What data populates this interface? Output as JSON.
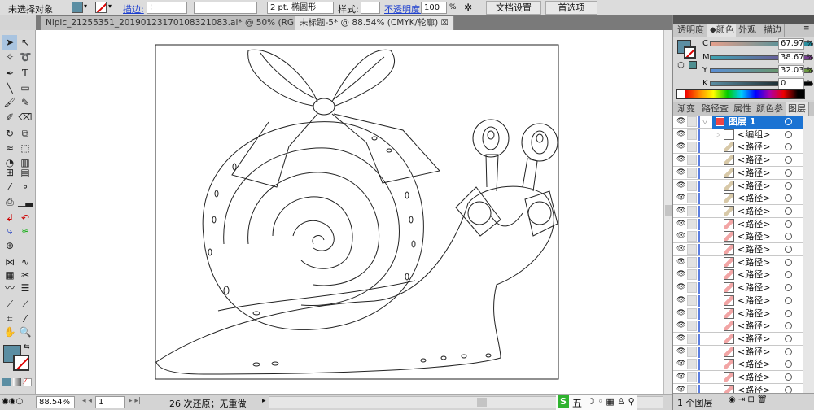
{
  "control_bar": {
    "selection": "未选择对象",
    "fill_color": "#5b8ea3",
    "stroke_label": "描边:",
    "stroke_weight": "2 pt. 椭圆形",
    "style_label": "样式:",
    "opacity_label": "不透明度:",
    "opacity_value": "100",
    "opacity_unit": "%",
    "doc_setup": "文档设置",
    "preferences": "首选项"
  },
  "tabs": [
    {
      "label": "Nipic_21255351_20190123170108321083.ai* @ 50% (RGB/轮廓)",
      "active": false
    },
    {
      "label": "未标题-5* @ 88.54% (CMYK/轮廓)",
      "active": true
    }
  ],
  "right_panel": {
    "top_tabs": [
      "透明度",
      "颜色",
      "外观",
      "描边"
    ],
    "active_top_tab": "颜色",
    "color": {
      "channels": [
        {
          "name": "C",
          "value": "67.97"
        },
        {
          "name": "M",
          "value": "38.67"
        },
        {
          "name": "Y",
          "value": "32.03"
        },
        {
          "name": "K",
          "value": "0"
        }
      ],
      "unit": "%",
      "swatch": "#5b8ea3"
    },
    "bottom_tabs": [
      "渐变",
      "路径查",
      "属性",
      "颜色参",
      "图层"
    ],
    "active_bottom_tab": "图层",
    "layers": [
      {
        "name": "图层 1",
        "selected": true
      },
      {
        "name": "<编组>"
      },
      {
        "name": "<路径>"
      },
      {
        "name": "<路径>"
      },
      {
        "name": "<路径>"
      },
      {
        "name": "<路径>"
      },
      {
        "name": "<路径>"
      },
      {
        "name": "<路径>"
      },
      {
        "name": "<路径>"
      },
      {
        "name": "<路径>"
      },
      {
        "name": "<路径>"
      },
      {
        "name": "<路径>"
      },
      {
        "name": "<路径>"
      },
      {
        "name": "<路径>"
      },
      {
        "name": "<路径>"
      },
      {
        "name": "<路径>"
      },
      {
        "name": "<路径>"
      },
      {
        "name": "<路径>"
      },
      {
        "name": "<路径>"
      },
      {
        "name": "<路径>"
      },
      {
        "name": "<路径>"
      },
      {
        "name": "<路径>"
      }
    ],
    "layer_count": "1 个图层"
  },
  "status": {
    "zoom": "88.54%",
    "page": "1",
    "history": "26 次还原；无重做"
  },
  "ime": {
    "label": "五"
  }
}
